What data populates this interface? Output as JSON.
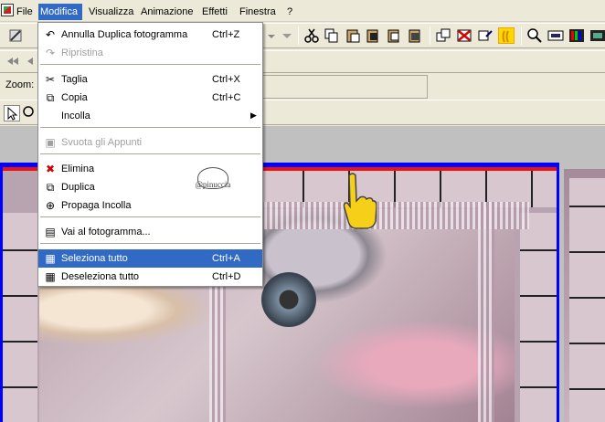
{
  "menubar": {
    "items": [
      "File",
      "Modifica",
      "Visualizza",
      "Animazione",
      "Effetti",
      "Finestra",
      "?"
    ]
  },
  "zoom": {
    "label": "Zoom:"
  },
  "dropdown": {
    "items": [
      {
        "label": "Annulla Duplica fotogramma",
        "shortcut": "Ctrl+Z",
        "icon": "undo-icon",
        "glyph": "↶"
      },
      {
        "label": "Ripristina",
        "shortcut": "",
        "icon": "redo-icon",
        "glyph": "↷",
        "disabled": true
      },
      {
        "label": "Taglia",
        "shortcut": "Ctrl+X",
        "icon": "scissors-icon",
        "glyph": "✂"
      },
      {
        "label": "Copia",
        "shortcut": "Ctrl+C",
        "icon": "copy-icon",
        "glyph": "⧉"
      },
      {
        "label": "Incolla",
        "shortcut": "",
        "icon": "",
        "glyph": "",
        "submenu": true
      },
      {
        "label": "Svuota gli Appunti",
        "shortcut": "",
        "icon": "clear-clipboard-icon",
        "glyph": "▣",
        "disabled": true
      },
      {
        "label": "Elimina",
        "shortcut": "",
        "icon": "delete-frame-icon",
        "glyph": "✖"
      },
      {
        "label": "Duplica",
        "shortcut": "",
        "icon": "duplicate-icon",
        "glyph": "⧉"
      },
      {
        "label": "Propaga Incolla",
        "shortcut": "",
        "icon": "propagate-paste-icon",
        "glyph": "⊕"
      },
      {
        "label": "Vai al fotogramma...",
        "shortcut": "",
        "icon": "go-to-frame-icon",
        "glyph": "▤"
      },
      {
        "label": "Seleziona tutto",
        "shortcut": "Ctrl+A",
        "icon": "select-all-icon",
        "glyph": "▦",
        "highlight": true
      },
      {
        "label": "Deseleziona tutto",
        "shortcut": "Ctrl+D",
        "icon": "deselect-all-icon",
        "glyph": "▦"
      }
    ]
  },
  "watermark": {
    "text": "@pinuccia"
  },
  "colors": {
    "menu_highlight": "#316ac5",
    "frame_border": "#0000ff",
    "frame_top": "#ee1111",
    "toolbar_bg": "#ece9d8"
  }
}
